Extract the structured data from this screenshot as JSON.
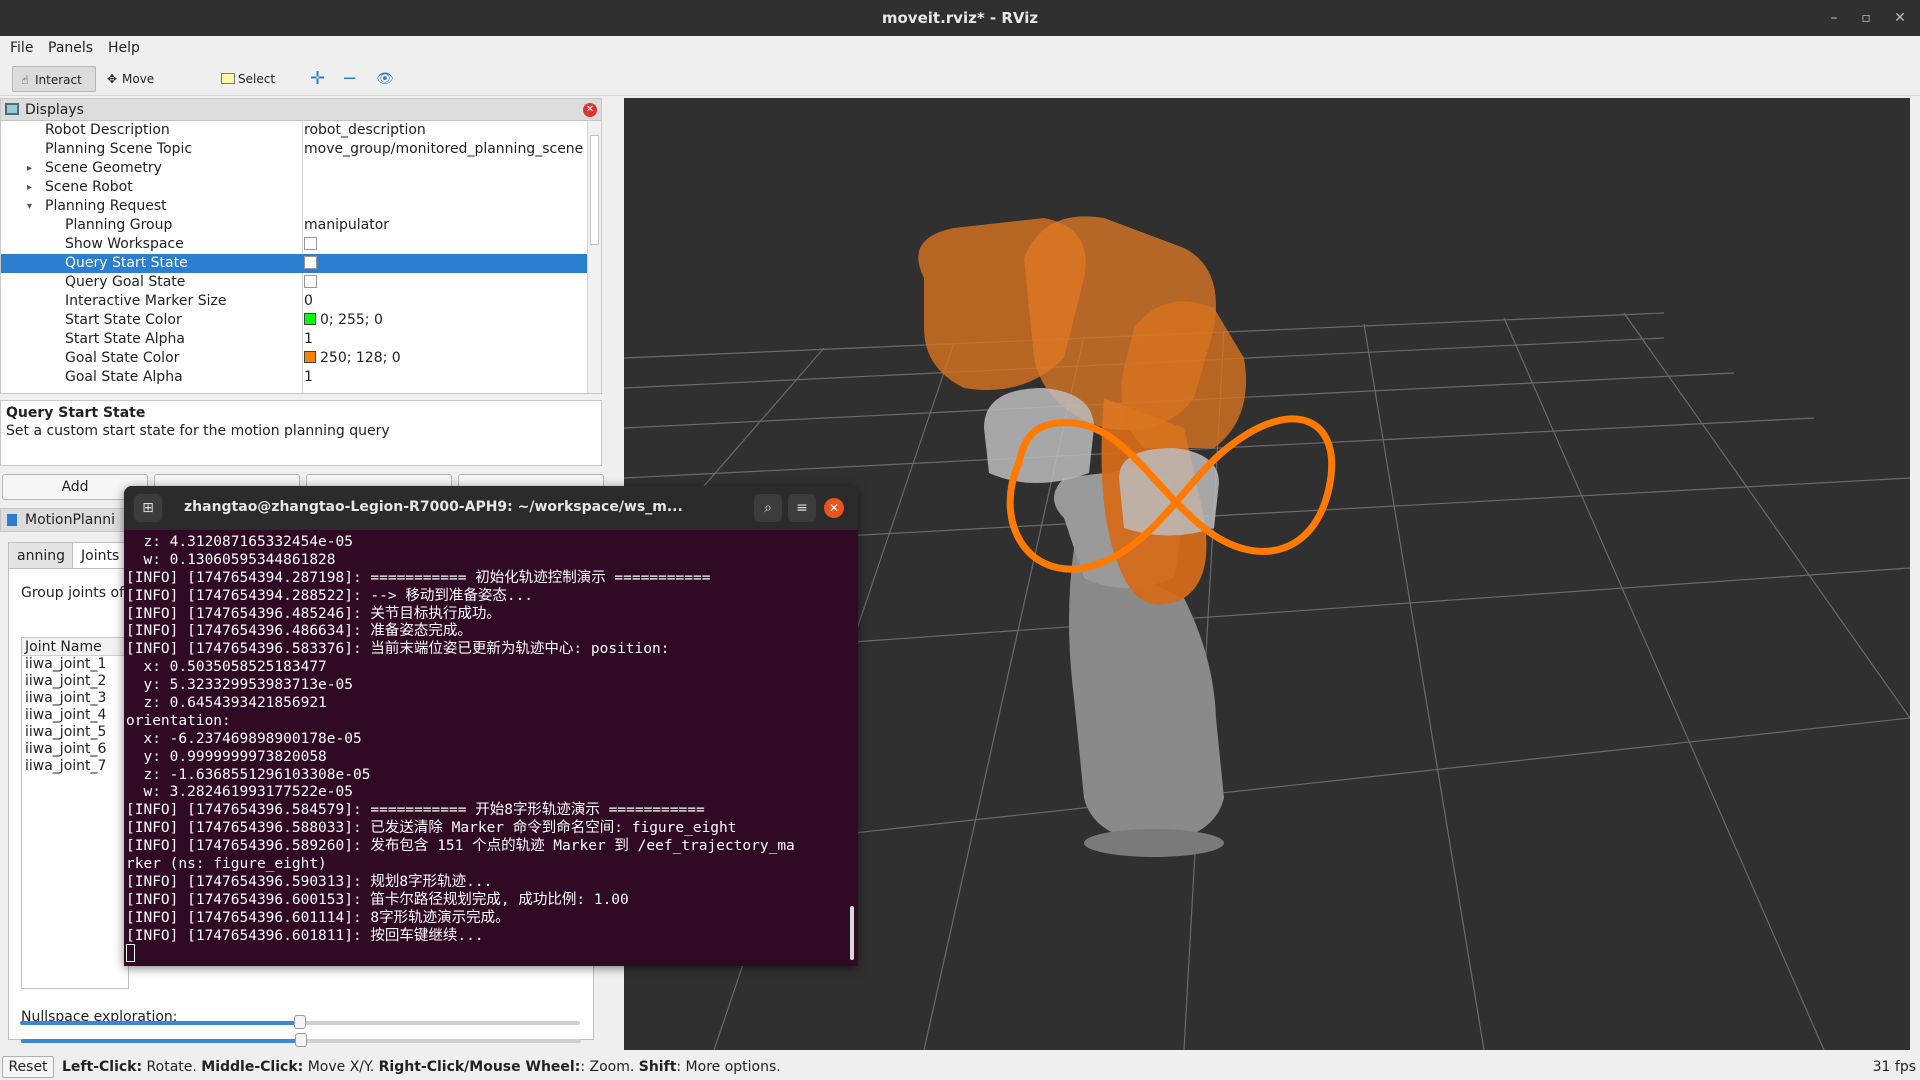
{
  "window": {
    "title": "moveit.rviz* - RViz"
  },
  "menubar": {
    "items": [
      "File",
      "Panels",
      "Help"
    ]
  },
  "toolbar": {
    "interact": "Interact",
    "move_camera": "Move Camera",
    "select": "Select"
  },
  "displays": {
    "title": "Displays",
    "rows": [
      {
        "name": "Robot Description",
        "value": "robot_description"
      },
      {
        "name": "Planning Scene Topic",
        "value": "move_group/monitored_planning_scene"
      },
      {
        "name": "Scene Geometry",
        "value": ""
      },
      {
        "name": "Scene Robot",
        "value": ""
      },
      {
        "name": "Planning Request",
        "value": ""
      },
      {
        "name": "Planning Group",
        "value": "manipulator"
      },
      {
        "name": "Show Workspace",
        "value": ""
      },
      {
        "name": "Query Start State",
        "value": ""
      },
      {
        "name": "Query Goal State",
        "value": ""
      },
      {
        "name": "Interactive Marker Size",
        "value": "0"
      },
      {
        "name": "Start State Color",
        "value": "0; 255; 0"
      },
      {
        "name": "Start State Alpha",
        "value": "1"
      },
      {
        "name": "Goal State Color",
        "value": "250; 128; 0"
      },
      {
        "name": "Goal State Alpha",
        "value": "1"
      }
    ],
    "start_color": "#00ff00",
    "goal_color": "#fa8000",
    "selected_row": "Query Start State"
  },
  "description": {
    "title": "Query Start State",
    "text": "Set a custom start state for the motion planning query"
  },
  "buttons": {
    "add": "Add"
  },
  "motion_planning": {
    "title": "MotionPlanni",
    "tabs": [
      "anning",
      "Joints"
    ],
    "group_label": "Group joints of",
    "joint_header": "Joint Name",
    "joints": [
      "iiwa_joint_1",
      "iiwa_joint_2",
      "iiwa_joint_3",
      "iiwa_joint_4",
      "iiwa_joint_5",
      "iiwa_joint_6",
      "iiwa_joint_7"
    ],
    "nullspace_label": "Nullspace exploration:",
    "sliders": [
      0.5,
      0.5
    ]
  },
  "terminal": {
    "title": "zhangtao@zhangtao-Legion-R7000-APH9: ~/workspace/ws_m...",
    "lines": [
      "  z: 4.312087165332454e-05",
      "  w: 0.13060595344861828",
      "[INFO] [1747654394.287198]: =========== 初始化轨迹控制演示 ===========",
      "[INFO] [1747654394.288522]: --> 移动到准备姿态...",
      "[INFO] [1747654396.485246]: 关节目标执行成功。",
      "[INFO] [1747654396.486634]: 准备姿态完成。",
      "[INFO] [1747654396.583376]: 当前末端位姿已更新为轨迹中心: position:",
      "  x: 0.5035058525183477",
      "  y: 5.323329953983713e-05",
      "  z: 0.6454393421856921",
      "orientation:",
      "  x: -6.237469898900178e-05",
      "  y: 0.9999999973820058",
      "  z: -1.6368551296103308e-05",
      "  w: 3.282461993177522e-05",
      "[INFO] [1747654396.584579]: =========== 开始8字形轨迹演示 ===========",
      "[INFO] [1747654396.588033]: 已发送清除 Marker 命令到命名空间: figure_eight",
      "[INFO] [1747654396.589260]: 发布包含 151 个点的轨迹 Marker 到 /eef_trajectory_ma",
      "rker (ns: figure_eight)",
      "[INFO] [1747654396.590313]: 规划8字形轨迹...",
      "[INFO] [1747654396.600153]: 笛卡尔路径规划完成, 成功比例: 1.00",
      "[INFO] [1747654396.601114]: 8字形轨迹演示完成。",
      "[INFO] [1747654396.601811]: 按回车键继续..."
    ]
  },
  "statusbar": {
    "reset": "Reset",
    "left_click": "Left-Click:",
    "left_action": " Rotate. ",
    "middle_click": "Middle-Click:",
    "middle_action": " Move X/Y. ",
    "right_click": "Right-Click/Mouse Wheel:",
    "right_action": ": Zoom. ",
    "shift": "Shift",
    "shift_action": ": More options.",
    "fps": "31 fps"
  },
  "colors": {
    "selection": "#2c7fd0",
    "viewport_bg": "#303030",
    "terminal_bg": "#300a24",
    "trajectory": "#ff7a00"
  }
}
